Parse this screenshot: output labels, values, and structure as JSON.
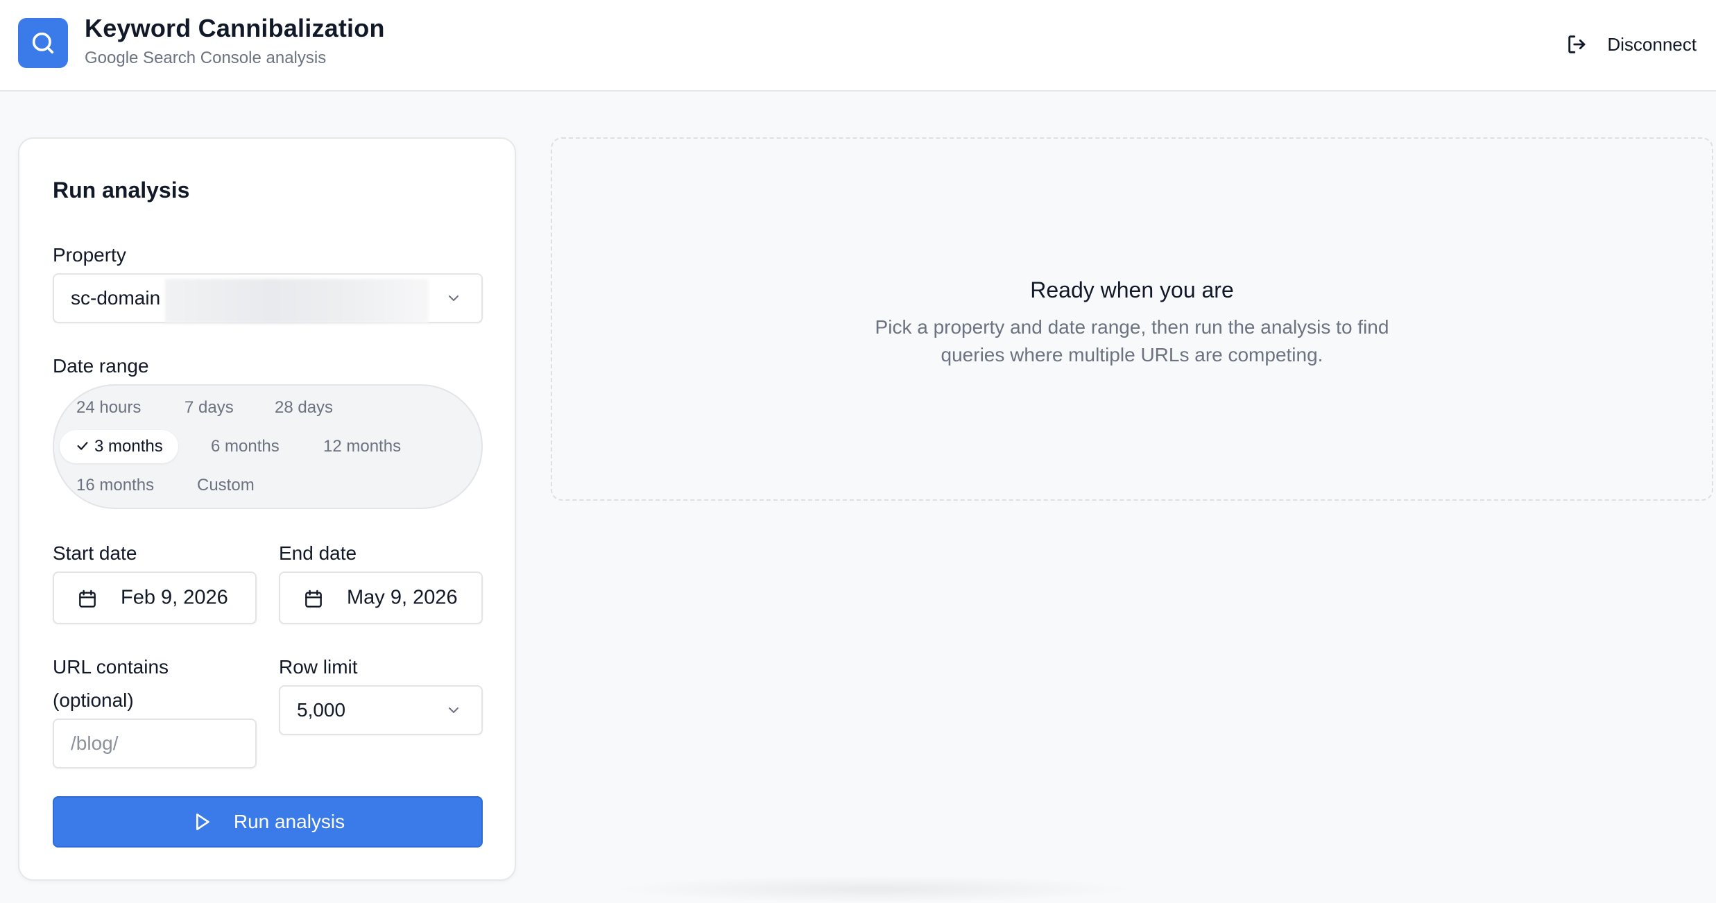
{
  "header": {
    "title": "Keyword Cannibalization",
    "subtitle": "Google Search Console analysis",
    "disconnect_label": "Disconnect"
  },
  "form": {
    "title": "Run analysis",
    "property": {
      "label": "Property",
      "value": "sc-domain"
    },
    "date_range": {
      "label": "Date range",
      "options": [
        "24 hours",
        "7 days",
        "28 days",
        "3 months",
        "6 months",
        "12 months",
        "16 months",
        "Custom"
      ],
      "selected": "3 months"
    },
    "start_date": {
      "label": "Start date",
      "value": "Feb 9, 2026"
    },
    "end_date": {
      "label": "End date",
      "value": "May 9, 2026"
    },
    "url_contains": {
      "label_line1": "URL contains",
      "label_line2": "(optional)",
      "placeholder": "/blog/"
    },
    "row_limit": {
      "label": "Row limit",
      "value": "5,000"
    },
    "run_button_label": "Run analysis"
  },
  "empty_state": {
    "title": "Ready when you are",
    "description": "Pick a property and date range, then run the analysis to find queries where multiple URLs are competing."
  },
  "colors": {
    "accent": "#3b7be9",
    "background": "#f8f9fb",
    "muted_text": "#6b7280"
  },
  "icons": {
    "logo": "search-icon",
    "disconnect": "logout-icon",
    "dropdown": "chevron-down-icon",
    "selected_chip": "check-icon",
    "date": "calendar-icon",
    "run": "play-icon"
  }
}
